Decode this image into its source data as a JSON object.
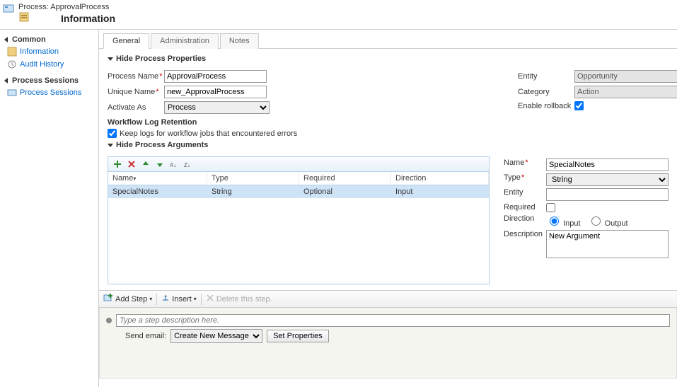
{
  "header": {
    "line1_prefix": "Process: ",
    "process_name": "ApprovalProcess",
    "line2": "Information"
  },
  "sidebar": {
    "common": "Common",
    "information": "Information",
    "audit": "Audit History",
    "sessions_header": "Process Sessions",
    "sessions_item": "Process Sessions"
  },
  "tabs": {
    "general": "General",
    "admin": "Administration",
    "notes": "Notes"
  },
  "props": {
    "section_title": "Hide Process Properties",
    "process_name_label": "Process Name",
    "process_name_value": "ApprovalProcess",
    "unique_name_label": "Unique Name",
    "unique_name_value": "new_ApprovalProcess",
    "activate_as_label": "Activate As",
    "activate_as_value": "Process",
    "entity_label": "Entity",
    "entity_value": "Opportunity",
    "category_label": "Category",
    "category_value": "Action",
    "rollback_label": "Enable rollback",
    "retention_header": "Workflow Log Retention",
    "retention_check": "Keep logs for workflow jobs that encountered errors"
  },
  "args": {
    "section_title": "Hide Process Arguments",
    "grid": {
      "headers": {
        "name": "Name",
        "type": "Type",
        "required": "Required",
        "direction": "Direction"
      },
      "sort_indicator": "▾",
      "rows": [
        {
          "name": "SpecialNotes",
          "type": "String",
          "required": "Optional",
          "direction": "Input"
        }
      ]
    },
    "detail": {
      "name_label": "Name",
      "name_value": "SpecialNotes",
      "type_label": "Type",
      "type_value": "String",
      "entity_label": "Entity",
      "entity_value": "",
      "required_label": "Required",
      "direction_label": "Direction",
      "direction_input": "Input",
      "direction_output": "Output",
      "description_label": "Description",
      "description_value": "New Argument"
    }
  },
  "steps": {
    "add_step": "Add Step",
    "insert": "Insert",
    "delete": "Delete this step.",
    "step_placeholder": "Type a step description here.",
    "send_email_label": "Send email:",
    "send_email_option": "Create New Message",
    "set_properties": "Set Properties"
  }
}
